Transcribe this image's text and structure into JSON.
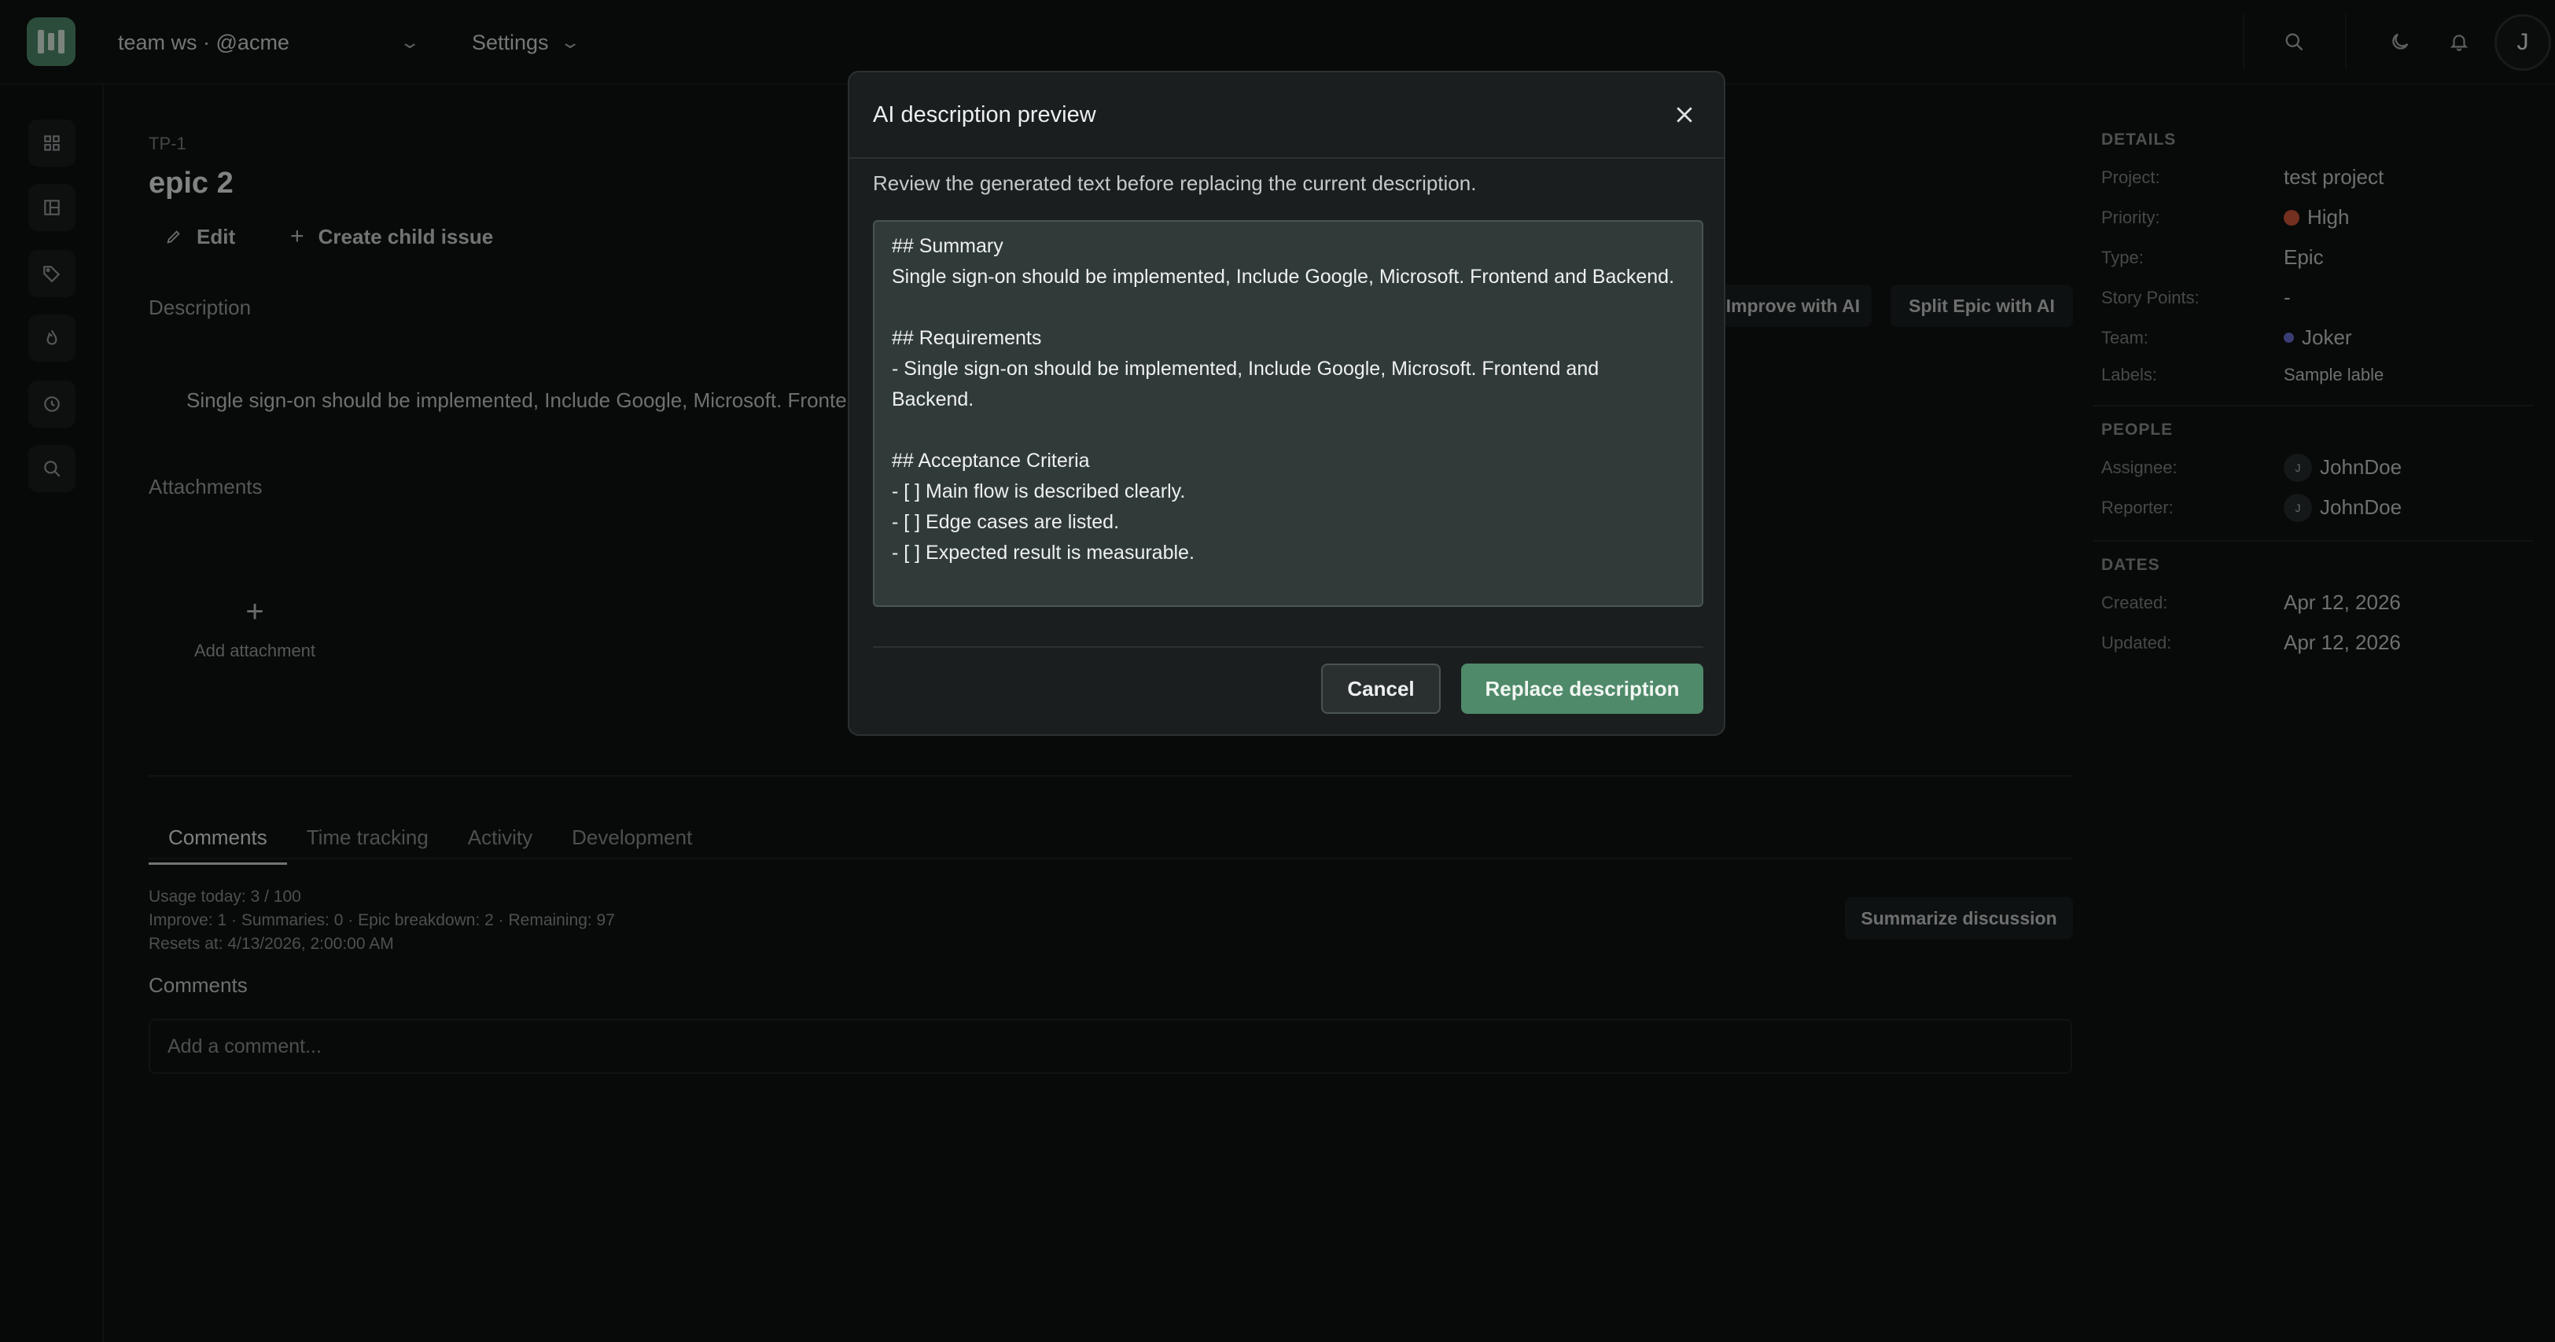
{
  "topbar": {
    "workspace_label": "team ws · @acme",
    "settings_label": "Settings",
    "avatar_initial": "J"
  },
  "issue": {
    "key": "TP-1",
    "title": "epic 2",
    "edit_label": "Edit",
    "create_child_label": "Create child issue",
    "description_label": "Description",
    "description_text": "Single sign-on should be implemented, Include Google, Microsoft. Fronte",
    "improve_ai_label": "Improve with AI",
    "split_epic_label": "Split Epic with AI",
    "attachments_label": "Attachments",
    "add_attachment_label": "Add attachment"
  },
  "tabs": [
    {
      "label": "Comments",
      "active": true
    },
    {
      "label": "Time tracking",
      "active": false
    },
    {
      "label": "Activity",
      "active": false
    },
    {
      "label": "Development",
      "active": false
    }
  ],
  "usage": {
    "line1": "Usage today: 3 / 100",
    "line2": "Improve: 1 · Summaries: 0 · Epic breakdown: 2 · Remaining: 97",
    "line3": "Resets at: 4/13/2026, 2:00:00 AM"
  },
  "comments": {
    "summarize_label": "Summarize discussion",
    "heading": "Comments",
    "placeholder": "Add a comment..."
  },
  "details": {
    "details_heading": "DETAILS",
    "project_key": "Project:",
    "project_val": "test project",
    "priority_key": "Priority:",
    "priority_val": "High",
    "type_key": "Type:",
    "type_val": "Epic",
    "points_key": "Story Points:",
    "points_val": "-",
    "team_key": "Team:",
    "team_val": "Joker",
    "labels_key": "Labels:",
    "labels_val": "Sample lable",
    "people_heading": "PEOPLE",
    "assignee_key": "Assignee:",
    "assignee_val": "JohnDoe",
    "reporter_key": "Reporter:",
    "reporter_val": "JohnDoe",
    "avatar_initial": "J",
    "dates_heading": "DATES",
    "created_key": "Created:",
    "created_val": "Apr 12, 2026",
    "updated_key": "Updated:",
    "updated_val": "Apr 12, 2026"
  },
  "modal": {
    "title": "AI description preview",
    "subtitle": "Review the generated text before replacing the current description.",
    "generated_text": "## Summary\nSingle sign-on should be implemented, Include Google, Microsoft. Frontend and Backend.\n\n## Requirements\n- Single sign-on should be implemented, Include Google, Microsoft. Frontend and Backend.\n\n## Acceptance Criteria\n- [ ] Main flow is described clearly.\n- [ ] Edge cases are listed.\n- [ ] Expected result is measurable.",
    "cancel_label": "Cancel",
    "replace_label": "Replace description"
  },
  "colors": {
    "accent": "#4f8a6a",
    "priority_high": "#d2573a",
    "team_dot": "#6b6fd4"
  },
  "icons": {
    "rail": [
      "grid-icon",
      "board-icon",
      "tag-icon",
      "flame-icon",
      "clock-icon",
      "search-icon"
    ],
    "topbar": [
      "search-icon",
      "moon-icon",
      "bell-icon"
    ]
  }
}
